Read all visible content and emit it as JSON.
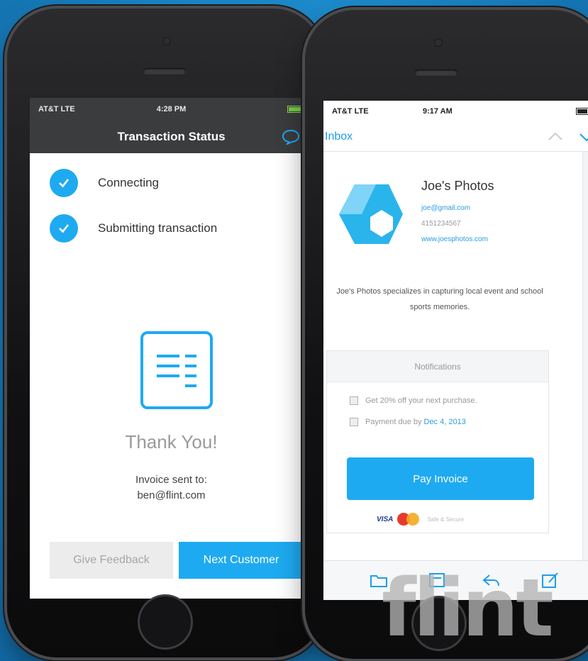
{
  "left_phone": {
    "status": {
      "carrier": "AT&T  LTE",
      "time": "4:28 PM"
    },
    "nav_title": "Transaction Status",
    "steps": [
      {
        "label": "Connecting"
      },
      {
        "label": "Submitting transaction"
      }
    ],
    "thank_you": "Thank You!",
    "invoice_line1": "Invoice sent to:",
    "invoice_email": "ben@flint.com",
    "buttons": {
      "feedback": "Give Feedback",
      "next": "Next Customer"
    }
  },
  "right_phone": {
    "status": {
      "carrier": "AT&T  LTE",
      "time": "9:17 AM"
    },
    "nav_back": "Inbox",
    "business": {
      "name": "Joe's Photos",
      "email": "joe@gmail.com",
      "phone": "4151234567",
      "website": "www.joesphotos.com",
      "description": "Joe's Photos specializes in capturing local event and school sports memories."
    },
    "notifications": {
      "header": "Notifications",
      "items": [
        {
          "text": "Get 20% off your next purchase."
        },
        {
          "text": "Payment due by",
          "date": "Dec 4, 2013"
        }
      ]
    },
    "pay_button": "Pay Invoice",
    "payment": {
      "visa": "VISA",
      "secure": "Safe & Secure"
    }
  },
  "watermark": "flint",
  "colors": {
    "accent": "#1eaaf1",
    "nav_dark": "#3b3c3e",
    "link": "#2a9be0"
  }
}
